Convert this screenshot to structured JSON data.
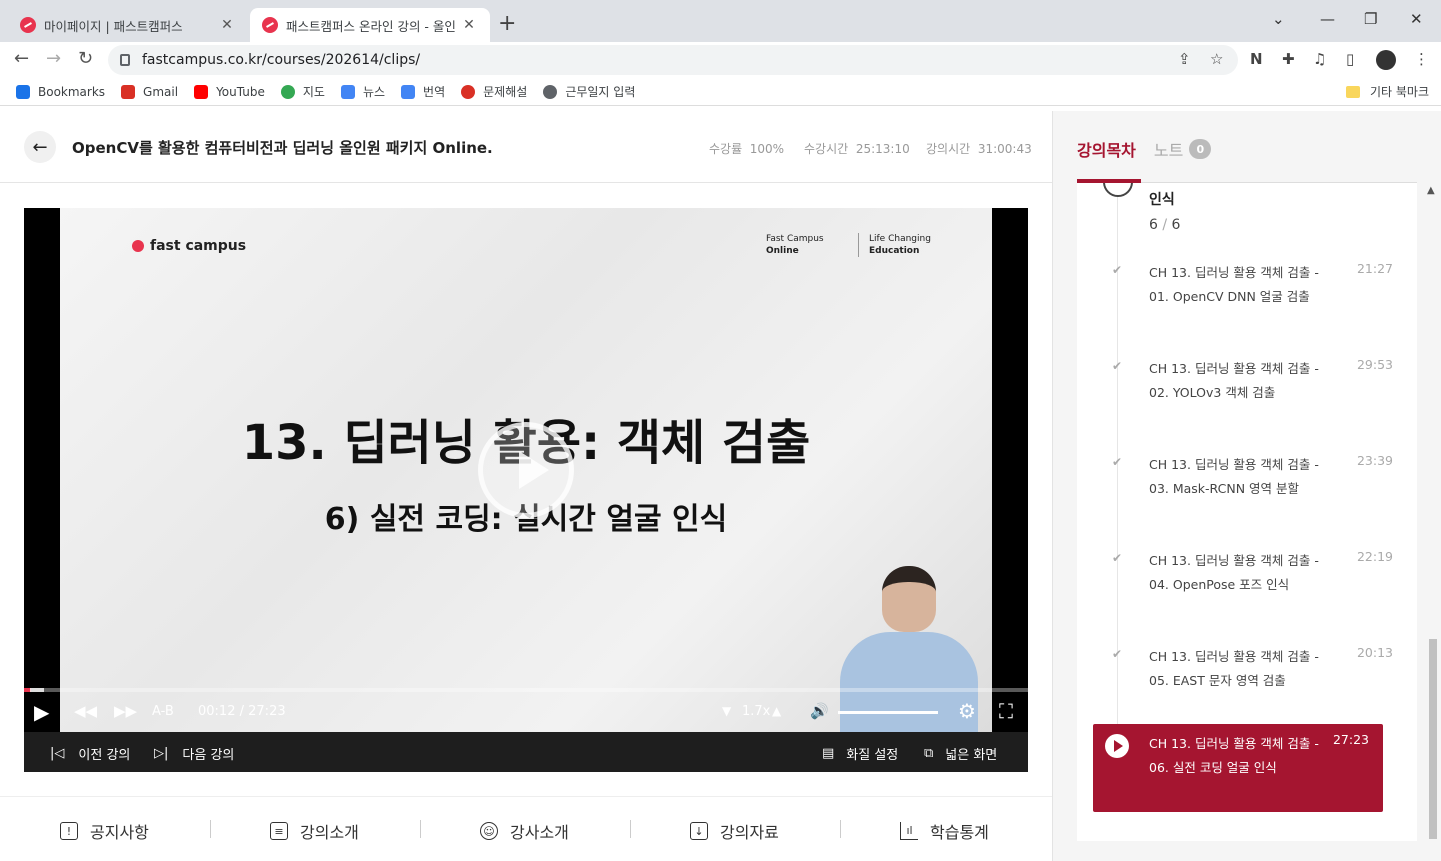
{
  "browser": {
    "tabs": [
      {
        "title": "마이페이지 | 패스트캠퍼스",
        "close": "✕"
      },
      {
        "title": "패스트캠퍼스 온라인 강의 - 올인",
        "close": "✕"
      }
    ],
    "new_tab": "+",
    "url": "fastcampus.co.kr/courses/202614/clips/",
    "bookmarks": [
      {
        "label": "Bookmarks",
        "color": "#1a73e8"
      },
      {
        "label": "Gmail",
        "color": "#d93025"
      },
      {
        "label": "YouTube",
        "color": "#ff0000"
      },
      {
        "label": "지도",
        "color": "#34a853"
      },
      {
        "label": "뉴스",
        "color": "#4285f4"
      },
      {
        "label": "번역",
        "color": "#4285f4"
      },
      {
        "label": "문제해설",
        "color": "#d93025"
      },
      {
        "label": "근무일지 입력",
        "color": "#5f6368"
      }
    ],
    "other_bookmarks": "기타 북마크"
  },
  "header": {
    "course_title": "OpenCV를 활용한 컴퓨터비전과 딥러닝 올인원 패키지 Online.",
    "stats": [
      {
        "label": "수강률",
        "value": "100%"
      },
      {
        "label": "수강시간",
        "value": "25:13:10"
      },
      {
        "label": "강의시간",
        "value": "31:00:43"
      }
    ]
  },
  "slide": {
    "logo": "fast campus",
    "brand_left_1": "Fast Campus",
    "brand_left_2": "Online",
    "brand_right_1": "Life Changing",
    "brand_right_2": "Education",
    "title": "13. 딥러닝 활용: 객체 검출",
    "subtitle": "6) 실전 코딩: 실시간 얼굴 인식"
  },
  "player": {
    "progress_fraction": 0.0073,
    "ab_label": "A-B",
    "current_time": "00:12",
    "time_sep": "/",
    "duration": "27:23",
    "speed": "1.7x",
    "volume_fraction": 1.0,
    "prev_lecture": "이전 강의",
    "next_lecture": "다음 강의",
    "quality": "화질 설정",
    "wide": "넓은 화면"
  },
  "bottom_tabs": [
    "공지사항",
    "강의소개",
    "강사소개",
    "강의자료",
    "학습통계"
  ],
  "sidebar": {
    "tab_toc": "강의목차",
    "tab_notes": "노트",
    "notes_count": "0",
    "prev_part_tail": "인식",
    "prev_count": "6",
    "prev_count_sep": "/",
    "prev_count_total": "6",
    "items": [
      {
        "title": "CH 13. 딥러닝 활용 객체 검출 - 01. OpenCV DNN 얼굴 검출",
        "duration": "21:27",
        "state": "done"
      },
      {
        "title": "CH 13. 딥러닝 활용 객체 검출 - 02. YOLOv3 객체 검출",
        "duration": "29:53",
        "state": "done"
      },
      {
        "title": "CH 13. 딥러닝 활용 객체 검출 - 03. Mask-RCNN 영역 분할",
        "duration": "23:39",
        "state": "done"
      },
      {
        "title": "CH 13. 딥러닝 활용 객체 검출 - 04. OpenPose 포즈 인식",
        "duration": "22:19",
        "state": "done"
      },
      {
        "title": "CH 13. 딥러닝 활용 객체 검출 - 05. EAST 문자 영역 검출",
        "duration": "20:13",
        "state": "done"
      },
      {
        "title": "CH 13. 딥러닝 활용 객체 검출 - 06. 실전 코딩 얼굴 인식",
        "duration": "27:23",
        "state": "current"
      }
    ]
  },
  "colors": {
    "accent": "#a51530",
    "brand": "#e8344e"
  }
}
